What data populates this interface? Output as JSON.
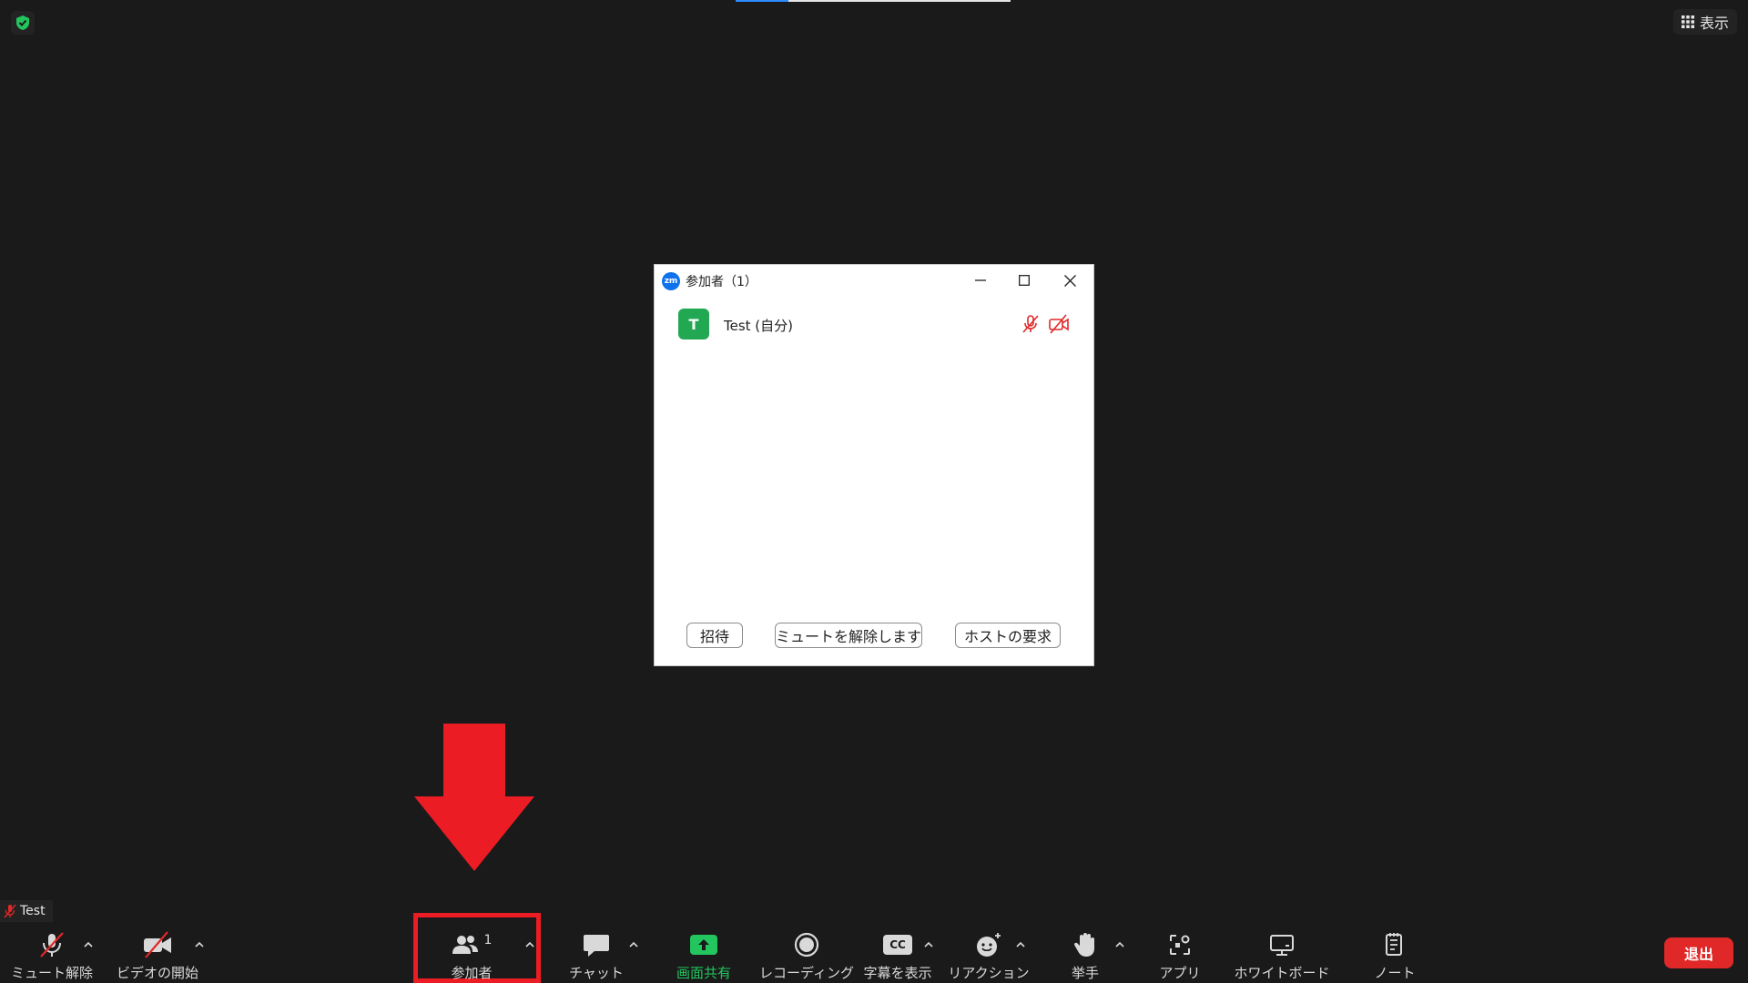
{
  "top": {
    "view_label": "表示"
  },
  "dialog": {
    "title": "参加者（1）",
    "logo_text": "zm",
    "participant": {
      "initial": "T",
      "name": "Test (自分)"
    },
    "buttons": {
      "invite": "招待",
      "unmute": "ミュートを解除します",
      "request_host": "ホストの要求"
    }
  },
  "nametag": {
    "name": "Test"
  },
  "toolbar": {
    "unmute": "ミュート解除",
    "start_video": "ビデオの開始",
    "participants": "参加者",
    "participants_count": "1",
    "chat": "チャット",
    "share_screen": "画面共有",
    "recording": "レコーディング",
    "captions": "字幕を表示",
    "reactions": "リアクション",
    "raise_hand": "挙手",
    "apps": "アプリ",
    "whiteboard": "ホワイトボード",
    "notes": "ノート",
    "exit": "退出",
    "cc_text": "CC"
  },
  "colors": {
    "background": "#1a1a1a",
    "accent_green": "#22c55e",
    "alert_red": "#ec1c24",
    "exit_red": "#e02828"
  }
}
